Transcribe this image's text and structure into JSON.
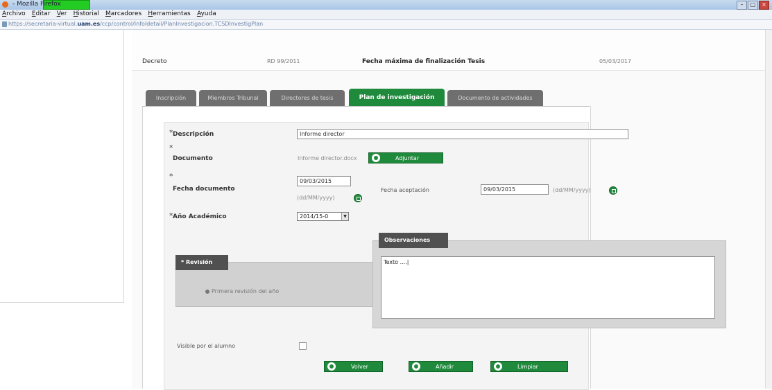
{
  "window": {
    "title": "- Mozilla Firefox"
  },
  "menu": [
    "Archivo",
    "Editar",
    "Ver",
    "Historial",
    "Marcadores",
    "Herramientas",
    "Ayuda"
  ],
  "url": {
    "prefix": "https://secretaria-virtual.",
    "domain": "uam.es",
    "path": "/ccp/control/InfoIdetail/PlanInvestigacion.TCSDInvestigPlan"
  },
  "header": {
    "decreto_label": "Decreto",
    "decreto_value": "RD 99/2011",
    "fecha_max_label": "Fecha máxima de finalización Tesis",
    "fecha_max_value": "05/03/2017"
  },
  "tabs": [
    {
      "label": "Inscripción",
      "active": false
    },
    {
      "label": "Miembros Tribunal",
      "active": false
    },
    {
      "label": "Directores de tesis",
      "active": false
    },
    {
      "label": "Plan de investigación",
      "active": true
    },
    {
      "label": "Documento de actividades",
      "active": false
    }
  ],
  "form": {
    "descripcion": {
      "label": "Descripción",
      "value": "Informe director"
    },
    "documento": {
      "label": "Documento",
      "file": "Informe director.docx",
      "button": "Adjuntar"
    },
    "fecha_documento": {
      "label": "Fecha documento",
      "value": "09/03/2015",
      "format": "(dd/MM/yyyy)"
    },
    "fecha_aceptacion": {
      "label": "Fecha aceptación",
      "value": "09/03/2015",
      "format": "(dd/MM/yyyy)"
    },
    "anio": {
      "label": "Año Académico",
      "value": "2014/15-0"
    },
    "revision": {
      "title": "* Revisión",
      "option": "Primera revisión del año"
    },
    "observaciones": {
      "title": "Observaciones",
      "value": "Texto ....|"
    },
    "visible": {
      "label": "Visible por el alumno"
    }
  },
  "buttons": {
    "volver": "Volver",
    "anadir": "Añadir",
    "limpiar": "Limpiar"
  },
  "colors": {
    "accent": "#1f8a3b",
    "tab_inactive": "#6f6f6f",
    "section_dark": "#505050"
  }
}
